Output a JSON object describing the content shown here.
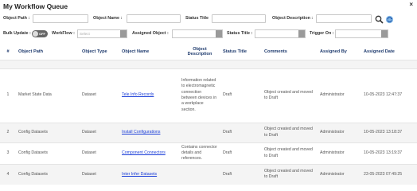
{
  "title": "My Workflow Queue",
  "close_label": "×",
  "filters": {
    "object_path_label": "Object Path :",
    "object_name_label": "Object Name :",
    "status_title_label": "Status Title",
    "object_description_label": "Object Description :",
    "bulk_update_label": "Bulk Update :",
    "toggle_label": "OFF",
    "workflow_label": "WorkFlow :",
    "workflow_placeholder": "Select",
    "assigned_object_label": "Assigned Object :",
    "status_title2_label": "Status Title :",
    "trigger_on_label": "Trigger On :"
  },
  "table": {
    "headers": [
      "#",
      "Object Path",
      "Object Type",
      "Object Name",
      "Object Description",
      "Status Title",
      "Comments",
      "Assigned By",
      "Assigned Date"
    ],
    "rows": [
      {
        "num": "1",
        "path": "Market State Data",
        "type": "Dataset",
        "name": "Tele Info Records",
        "description": "Information related to electromagnetic connection between devices in a workplace section.",
        "status": "Draft",
        "comments": "Object created and moved to Draft",
        "assigned_by": "Administrator",
        "assigned_date": "10-05-2023 12:47:37"
      },
      {
        "num": "2",
        "path": "Config Datasets",
        "type": "Dataset",
        "name": "Install Configurations",
        "description": "",
        "status": "Draft",
        "comments": "Object created and moved to Draft",
        "assigned_by": "Administrator",
        "assigned_date": "10-05-2023 13:18:37"
      },
      {
        "num": "3",
        "path": "Config Datasets",
        "type": "Dataset",
        "name": "Component Connectors",
        "description": "Contains connector details and references.",
        "status": "Draft",
        "comments": "Object created and moved to Draft",
        "assigned_by": "Administrator",
        "assigned_date": "10-05-2023 13:19:37"
      },
      {
        "num": "4",
        "path": "Config Datasets",
        "type": "Dataset",
        "name": "Inter Infer Datasets",
        "description": "",
        "status": "Draft",
        "comments": "Object created and moved to Draft",
        "assigned_by": "Administrator",
        "assigned_date": "23-05-2023 07:49:25"
      }
    ]
  }
}
